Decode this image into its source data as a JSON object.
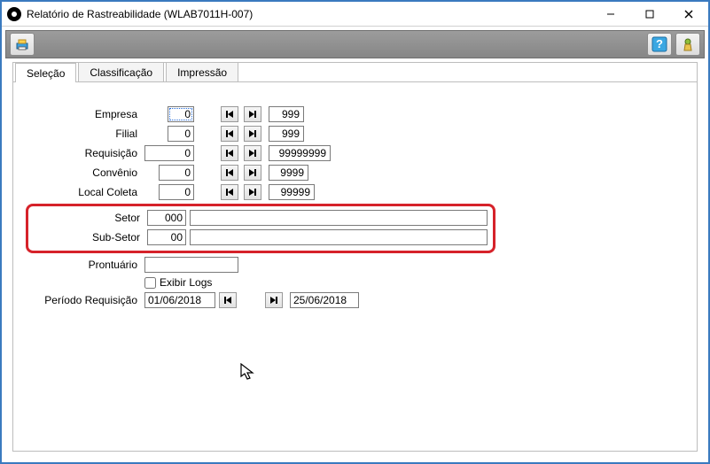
{
  "window": {
    "title": "Relatório de Rastreabilidade (WLAB7011H-007)"
  },
  "tabs": {
    "selection": "Seleção",
    "classification": "Classificação",
    "printing": "Impressão"
  },
  "form": {
    "empresa": {
      "label": "Empresa",
      "from": "0",
      "to": "999"
    },
    "filial": {
      "label": "Filial",
      "from": "0",
      "to": "999"
    },
    "requisicao": {
      "label": "Requisição",
      "from": "0",
      "to": "99999999"
    },
    "convenio": {
      "label": "Convênio",
      "from": "0",
      "to": "9999"
    },
    "local_coleta": {
      "label": "Local Coleta",
      "from": "0",
      "to": "99999"
    },
    "setor": {
      "label": "Setor",
      "code": "000",
      "desc": ""
    },
    "subsetor": {
      "label": "Sub-Setor",
      "code": "00",
      "desc": ""
    },
    "prontuario": {
      "label": "Prontuário",
      "value": ""
    },
    "exibir_logs": {
      "label": "Exibir Logs",
      "checked": false
    },
    "periodo": {
      "label": "Período Requisição",
      "from": "01/06/2018",
      "to": "25/06/2018"
    }
  }
}
